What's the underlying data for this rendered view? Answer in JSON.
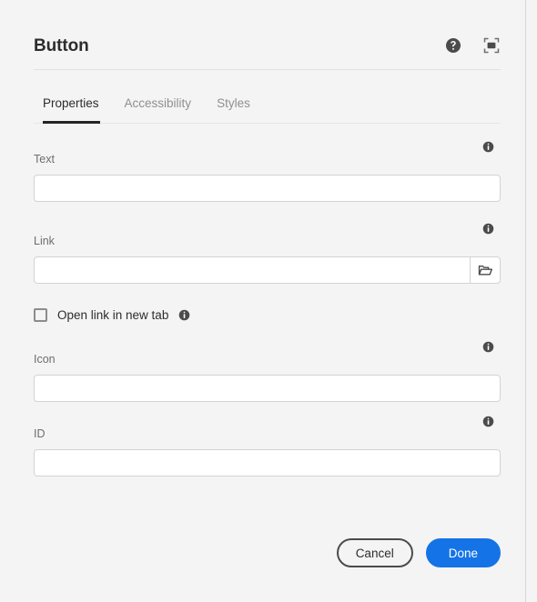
{
  "dialog": {
    "title": "Button",
    "header_actions": [
      {
        "name": "help-icon",
        "label": "Help"
      },
      {
        "name": "fullscreen-icon",
        "label": "Full screen"
      }
    ]
  },
  "tabs": [
    {
      "label": "Properties",
      "active": true
    },
    {
      "label": "Accessibility",
      "active": false
    },
    {
      "label": "Styles",
      "active": false
    }
  ],
  "fields": {
    "text": {
      "label": "Text",
      "value": "",
      "placeholder": ""
    },
    "link": {
      "label": "Link",
      "value": "",
      "placeholder": "",
      "browse_icon": "folder-icon"
    },
    "open_in_new_tab": {
      "label": "Open link in new tab",
      "checked": false
    },
    "icon": {
      "label": "Icon",
      "value": "",
      "placeholder": ""
    },
    "id": {
      "label": "ID",
      "value": "",
      "placeholder": ""
    }
  },
  "footer": {
    "cancel_label": "Cancel",
    "done_label": "Done"
  },
  "colors": {
    "background": "#f4f4f4",
    "primary": "#1473e6",
    "text": "#2c2c2c",
    "label": "#6e6e6e",
    "border": "#d3d3d3",
    "tab_active_indicator": "#242424"
  }
}
